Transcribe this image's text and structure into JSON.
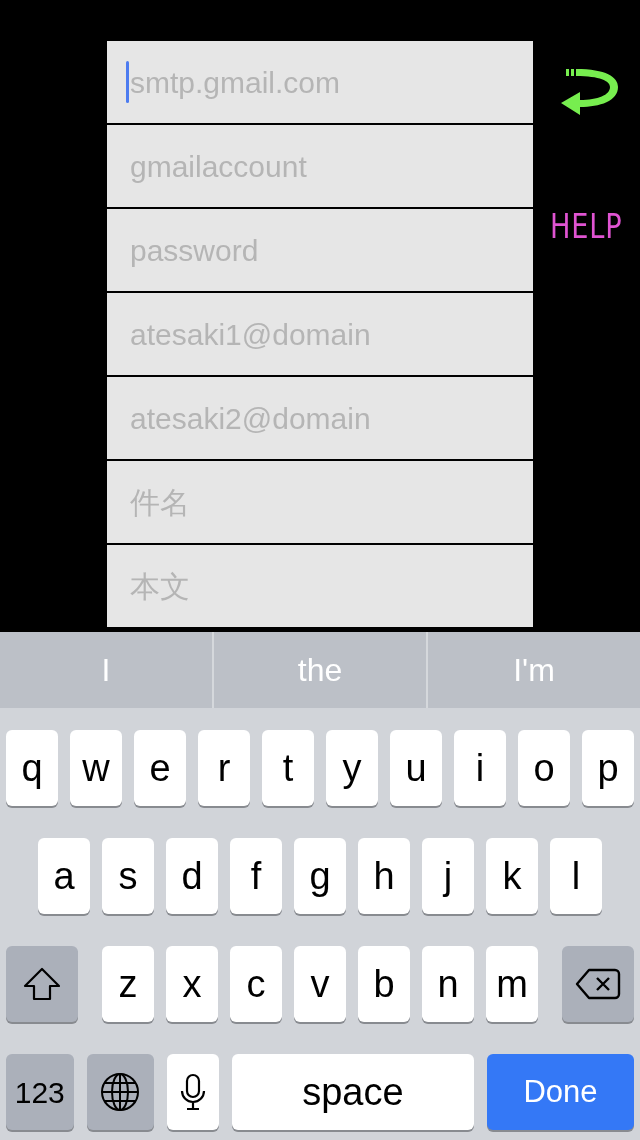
{
  "fields": [
    {
      "placeholder": "smtp.gmail.com",
      "focused": true
    },
    {
      "placeholder": "gmailaccount",
      "focused": false
    },
    {
      "placeholder": "password",
      "focused": false
    },
    {
      "placeholder": "atesaki1@domain",
      "focused": false
    },
    {
      "placeholder": "atesaki2@domain",
      "focused": false
    },
    {
      "placeholder": "件名",
      "focused": false
    },
    {
      "placeholder": "本文",
      "focused": false
    }
  ],
  "help_button": "HELP",
  "keyboard": {
    "suggestions": [
      "I",
      "the",
      "I'm"
    ],
    "rows": [
      [
        "q",
        "w",
        "e",
        "r",
        "t",
        "y",
        "u",
        "i",
        "o",
        "p"
      ],
      [
        "a",
        "s",
        "d",
        "f",
        "g",
        "h",
        "j",
        "k",
        "l"
      ],
      [
        "z",
        "x",
        "c",
        "v",
        "b",
        "n",
        "m"
      ]
    ],
    "bottom_row": [
      {
        "kind": "numbers",
        "label": "123"
      },
      {
        "kind": "globe"
      },
      {
        "kind": "mic"
      },
      {
        "kind": "space",
        "label": "space"
      },
      {
        "kind": "done",
        "label": "Done"
      }
    ]
  }
}
